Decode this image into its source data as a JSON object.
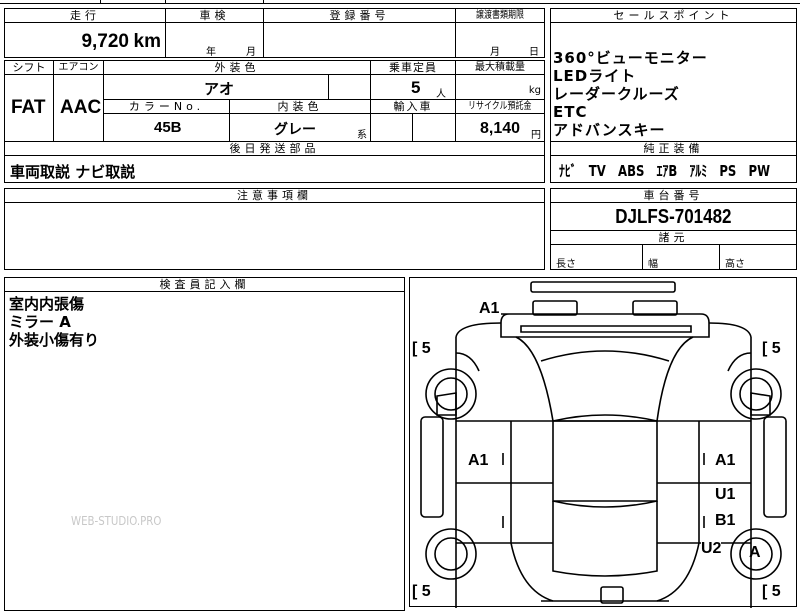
{
  "header": {
    "mileage_label": "走行",
    "mileage_value": "9,720",
    "mileage_unit": "km",
    "inspection_label": "車検",
    "year_unit": "年",
    "month_unit": "月",
    "registration_label": "登録番号",
    "transfer_label": "譲渡書類期限",
    "transfer_month": "月",
    "transfer_day": "日"
  },
  "specs": {
    "shift_label": "シフト",
    "shift_value": "FAT",
    "aircon_label": "エアコン",
    "aircon_value": "AAC",
    "exterior_label": "外装色",
    "exterior_value": "アオ",
    "capacity_label": "乗車定員",
    "capacity_value": "5",
    "capacity_unit": "人",
    "load_label": "最大積載量",
    "load_unit": "kg",
    "color_no_label": "カラーNo.",
    "color_no_value": "45B",
    "interior_label": "内装色",
    "interior_value": "グレー",
    "interior_unit": "系",
    "import_label": "輸入車",
    "recycle_label": "リサイクル預託金",
    "recycle_value": "8,140",
    "recycle_unit": "円"
  },
  "later": {
    "label": "後日発送部品",
    "value": "車両取説 ナビ取説"
  },
  "notes": {
    "label": "注意事項欄"
  },
  "sales_points": {
    "label": "セールスポイント",
    "items": [
      "360°ビューモニター",
      "LEDライト",
      "レーダークルーズ",
      "ETC",
      "アドバンスキー"
    ]
  },
  "equipment": {
    "label": "純正装備",
    "items": [
      "ﾅﾋﾞ",
      "TV",
      "ABS",
      "ｴｱB",
      "ｱﾙﾐ",
      "PS",
      "PW"
    ]
  },
  "chassis": {
    "label": "車台番号",
    "value": "DJLFS-701482"
  },
  "dims": {
    "label": "諸元",
    "length": "長さ",
    "width": "幅",
    "height": "高さ"
  },
  "inspector": {
    "label": "検査員記入欄",
    "lines": [
      "室内内張傷",
      "ミラー A",
      "外装小傷有り"
    ]
  },
  "watermark": "WEB-STUDIO.PRO",
  "diagram": {
    "marks": {
      "front_top": "A1",
      "left_door": "A1",
      "right_door": "A1",
      "right_rear_door_1": "U1",
      "right_rear_door_2": "B1",
      "right_rear_quarter": "U2",
      "tire_right_rear": "A"
    },
    "tire_fl": "[ 5",
    "tire_fr": "[ 5",
    "tire_rl": "[ 5",
    "tire_rr": "[ 5"
  }
}
